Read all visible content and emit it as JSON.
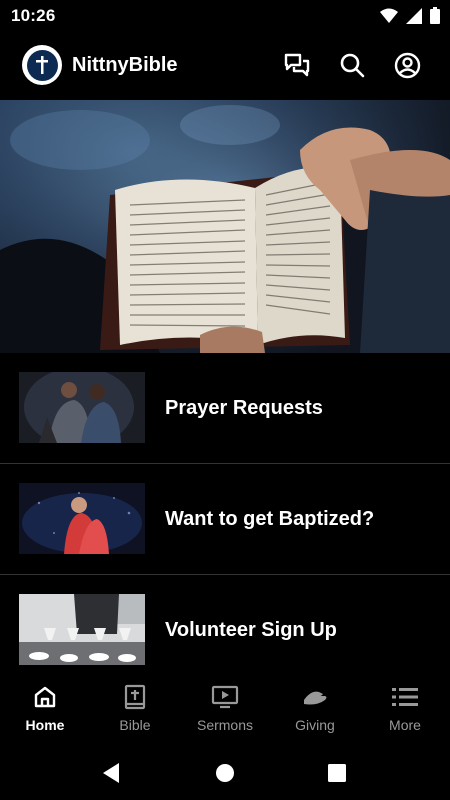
{
  "status_bar": {
    "time": "10:26"
  },
  "app_bar": {
    "title": "NittnyBible"
  },
  "list": [
    {
      "label": "Prayer Requests"
    },
    {
      "label": "Want to get Baptized?"
    },
    {
      "label": "Volunteer Sign Up"
    }
  ],
  "nav": [
    {
      "label": "Home",
      "icon": "home-icon",
      "active": true
    },
    {
      "label": "Bible",
      "icon": "bible-icon"
    },
    {
      "label": "Sermons",
      "icon": "sermons-icon"
    },
    {
      "label": "Giving",
      "icon": "giving-icon"
    },
    {
      "label": "More",
      "icon": "menu-icon"
    }
  ],
  "colors": {
    "background": "#000000",
    "text": "#ffffff",
    "inactive": "#999999",
    "divider": "#333333"
  }
}
